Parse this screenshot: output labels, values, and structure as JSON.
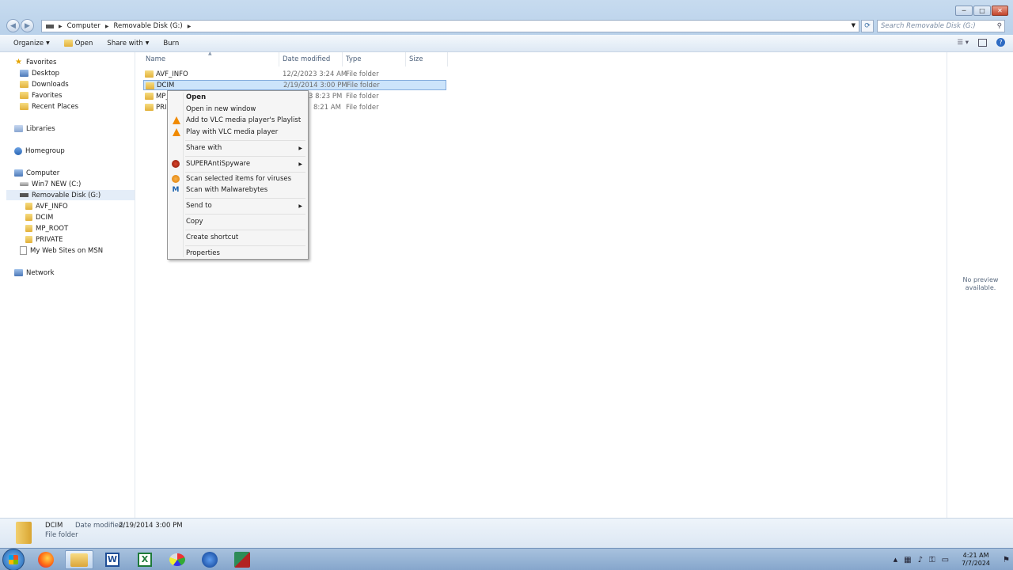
{
  "titlebar": {
    "minimize": "─",
    "maximize": "□",
    "close": "✕"
  },
  "address": {
    "segments": [
      "Computer",
      "Removable Disk (G:)"
    ],
    "search_placeholder": "Search Removable Disk (G:)"
  },
  "toolbar": {
    "organize": "Organize",
    "open": "Open",
    "share_with": "Share with",
    "burn": "Burn"
  },
  "nav": {
    "favorites": "Favorites",
    "desktop": "Desktop",
    "downloads": "Downloads",
    "favorites_item": "Favorites",
    "recent_places": "Recent Places",
    "libraries": "Libraries",
    "homegroup": "Homegroup",
    "computer": "Computer",
    "win7": "Win7 NEW (C:)",
    "removable": "Removable Disk (G:)",
    "avf_info": "AVF_INFO",
    "dcim": "DCIM",
    "mp_root": "MP_ROOT",
    "private": "PRIVATE",
    "msn": "My Web Sites on MSN",
    "network": "Network"
  },
  "columns": {
    "name": "Name",
    "date_modified": "Date modified",
    "type": "Type",
    "size": "Size"
  },
  "files": [
    {
      "name": "AVF_INFO",
      "date": "12/2/2023 3:24 AM",
      "type": "File folder"
    },
    {
      "name": "DCIM",
      "date": "2/19/2014 3:00 PM",
      "type": "File folder"
    },
    {
      "name": "MP_",
      "date": "3 8:23 PM",
      "type": "File folder"
    },
    {
      "name": "PRI",
      "date": "8:21 AM",
      "type": "File folder"
    }
  ],
  "context_menu": {
    "open": "Open",
    "open_new_window": "Open in new window",
    "vlc_playlist": "Add to VLC media player's Playlist",
    "vlc_play": "Play with VLC media player",
    "share_with": "Share with",
    "superantispyware": "SUPERAntiSpyware",
    "scan_viruses": "Scan selected items for viruses",
    "scan_malwarebytes": "Scan with Malwarebytes",
    "send_to": "Send to",
    "copy": "Copy",
    "create_shortcut": "Create shortcut",
    "properties": "Properties"
  },
  "preview": {
    "line1": "No preview",
    "line2": "available."
  },
  "details": {
    "name": "DCIM",
    "date_label": "Date modified:",
    "date_value": "2/19/2014 3:00 PM",
    "type": "File folder"
  },
  "clock": {
    "time": "4:21 AM",
    "date": "7/7/2024"
  }
}
